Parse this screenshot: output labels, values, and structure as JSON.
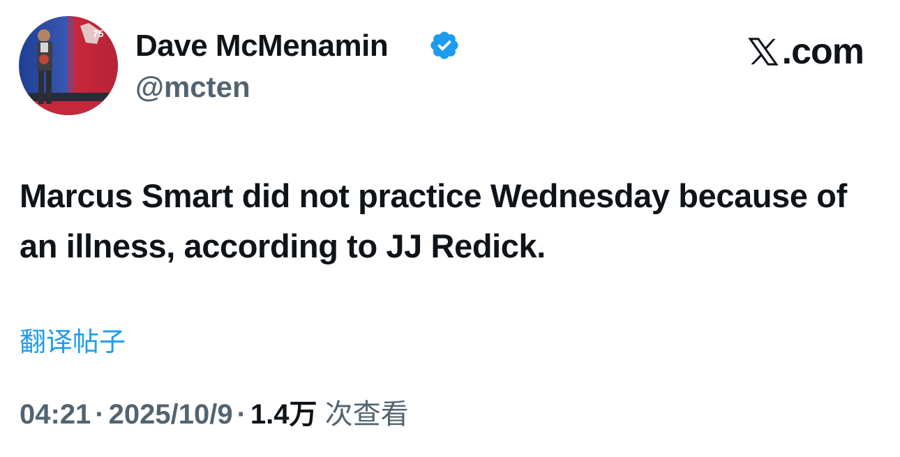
{
  "author": {
    "display_name": "Dave McMenamin",
    "handle": "@mcten",
    "verified": true
  },
  "brand": {
    "domain": ".com"
  },
  "tweet": {
    "text": "Marcus Smart did not practice Wednesday because of an illness, according to JJ Redick.",
    "translate_label": "翻译帖子"
  },
  "meta": {
    "time": "04:21",
    "separator": "·",
    "date": "2025/10/9",
    "views_count": "1.4万",
    "views_label": "次查看"
  },
  "colors": {
    "link": "#1d9bf0",
    "secondary_text": "#536471",
    "primary_text": "#0f1419",
    "verified": "#1d9bf0"
  },
  "icons": {
    "verified": "verified-badge-icon",
    "logo": "x-logo-icon"
  }
}
